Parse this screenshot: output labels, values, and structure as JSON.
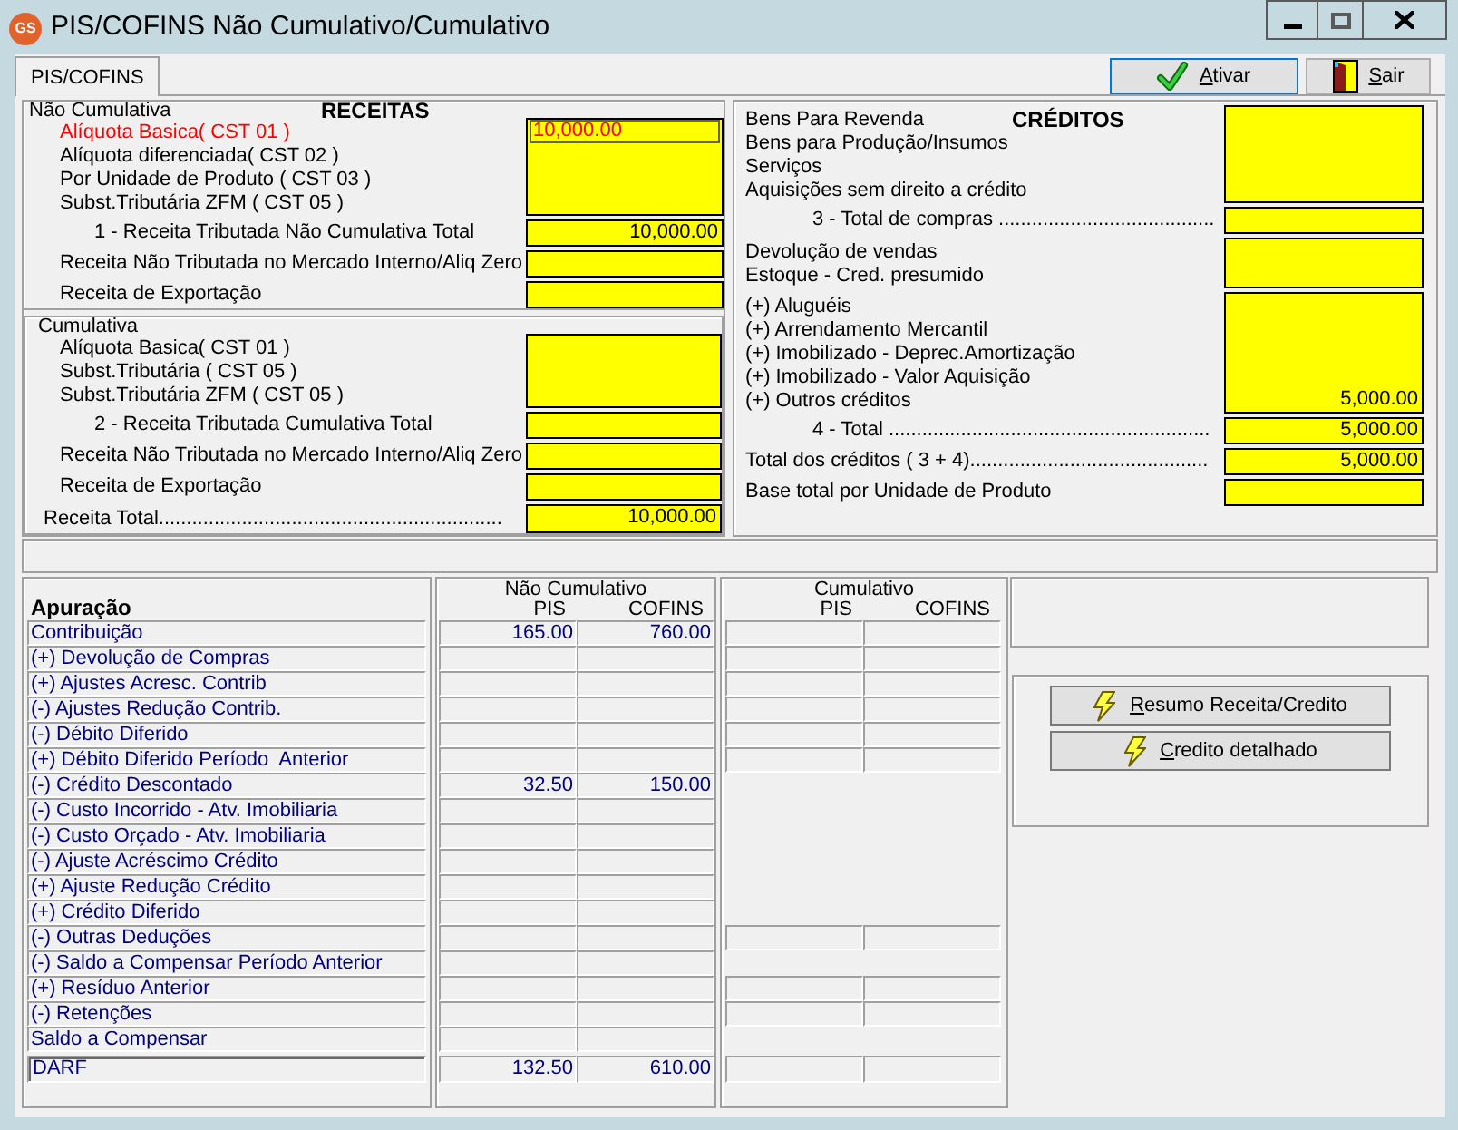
{
  "window": {
    "logo": "GS",
    "title": "PIS/COFINS Não Cumulativo/Cumulativo"
  },
  "tabs": [
    {
      "label": "PIS/COFINS",
      "selected": true
    }
  ],
  "toolbar": [
    {
      "label": "Ativar",
      "focused": true
    },
    {
      "label": "Sair",
      "focused": false
    }
  ],
  "receitas": {
    "title": "RECEITAS",
    "sections": [
      {
        "heading": "Não Cumulativa",
        "blocks": [
          {
            "kind": "group",
            "lines": [
              {
                "label": "Alíquota Basica( CST 01 )",
                "focused": true,
                "value": "10,000.00"
              },
              {
                "label": "Alíquota diferenciada( CST 02 )",
                "focused": false
              },
              {
                "label": "Por Unidade de Produto ( CST 03 )",
                "focused": false
              },
              {
                "label": "Subst.Tributária ZFM ( CST 05 )",
                "focused": false
              }
            ]
          },
          {
            "kind": "subtotal",
            "label": "1 - Receita Tributada Não Cumulativa Total",
            "value": "10,000.00"
          },
          {
            "kind": "item",
            "label": "Receita Não Tributada no Mercado Interno/Aliq Zero"
          },
          {
            "kind": "item",
            "label": "Receita de Exportação"
          }
        ]
      },
      {
        "heading": "Cumulativa",
        "blocks": [
          {
            "kind": "group",
            "lines": [
              {
                "label": "Alíquota Basica( CST 01 )",
                "focused": false
              },
              {
                "label": "Subst.Tributária ( CST 05 )",
                "focused": false
              },
              {
                "label": "Subst.Tributária ZFM ( CST 05 )",
                "focused": false
              }
            ]
          },
          {
            "kind": "subtotal",
            "label": "2 - Receita Tributada Cumulativa Total"
          },
          {
            "kind": "item",
            "label": "Receita Não Tributada no Mercado Interno/Aliq Zero"
          },
          {
            "kind": "item",
            "label": "Receita de Exportação"
          },
          {
            "kind": "total",
            "label": "Receita Total..............................................................",
            "value": "10,000.00"
          }
        ]
      }
    ]
  },
  "creditos": {
    "title": "CRÉDITOS",
    "blocks": [
      {
        "kind": "group",
        "lines": [
          {
            "label": "Bens Para Revenda",
            "focused": false
          },
          {
            "label": "Bens para Produção/Insumos",
            "focused": false
          },
          {
            "label": "Serviços",
            "focused": false
          },
          {
            "label": "Aquisições sem direito a crédito",
            "focused": false
          }
        ]
      },
      {
        "kind": "subtotal",
        "label": "3 - Total de compras ......................................."
      },
      {
        "kind": "group",
        "lines": [
          {
            "label": "Devolução de vendas",
            "focused": false
          },
          {
            "label": "Estoque - Cred. presumido",
            "focused": false
          }
        ]
      },
      {
        "kind": "group",
        "lines": [
          {
            "label": "(+) Aluguéis",
            "focused": false
          },
          {
            "label": "(+) Arrendamento Mercantil",
            "focused": false
          },
          {
            "label": "(+) Imobilizado - Deprec.Amortização",
            "focused": false
          },
          {
            "label": "(+) Imobilizado - Valor Aquisição",
            "focused": false
          },
          {
            "label": "(+) Outros créditos",
            "focused": false,
            "value": "5,000.00"
          }
        ]
      },
      {
        "kind": "subtotal",
        "label": "4 - Total ..........................................................",
        "value": "5,000.00"
      },
      {
        "kind": "item",
        "label": "Total dos créditos ( 3 + 4)...........................................",
        "value": "5,000.00"
      },
      {
        "kind": "item",
        "label": "Base total por Unidade de Produto"
      }
    ]
  },
  "apuracao": {
    "title": "Apuração",
    "groups": [
      {
        "title": "Não Cumulativo",
        "columns": [
          "PIS",
          "COFINS"
        ]
      },
      {
        "title": "Cumulativo",
        "columns": [
          "PIS",
          "COFINS"
        ]
      }
    ],
    "rows": [
      {
        "label": "Contribuição",
        "nao_cumulativo": {
          "pis": "165.00",
          "cofins": "760.00"
        },
        "cumulativo_cells": true
      },
      {
        "label": "(+) Devolução de Compras",
        "cumulativo_cells": true
      },
      {
        "label": "(+) Ajustes Acresc. Contrib",
        "cumulativo_cells": true
      },
      {
        "label": "(-) Ajustes Redução Contrib.",
        "cumulativo_cells": true
      },
      {
        "label": "(-) Débito Diferido",
        "cumulativo_cells": true
      },
      {
        "label": "(+) Débito Diferido Período  Anterior",
        "cumulativo_cells": true
      },
      {
        "label": "(-) Crédito Descontado",
        "nao_cumulativo": {
          "pis": "32.50",
          "cofins": "150.00"
        },
        "cumulativo_cells": false
      },
      {
        "label": "(-) Custo Incorrido - Atv. Imobiliaria",
        "cumulativo_cells": false
      },
      {
        "label": "(-) Custo Orçado - Atv. Imobiliaria",
        "cumulativo_cells": false
      },
      {
        "label": "(-) Ajuste Acréscimo Crédito",
        "cumulativo_cells": false
      },
      {
        "label": "(+) Ajuste Redução Crédito",
        "cumulativo_cells": false
      },
      {
        "label": "(+) Crédito Diferido",
        "cumulativo_cells": false
      },
      {
        "label": "(-) Outras Deduções",
        "cumulativo_cells": true
      },
      {
        "label": "(-) Saldo a Compensar Período Anterior",
        "cumulativo_cells": false
      },
      {
        "label": "(+) Resíduo Anterior",
        "cumulativo_cells": true
      },
      {
        "label": "(-) Retenções",
        "cumulativo_cells": true
      },
      {
        "label": "Saldo a Compensar",
        "cumulativo_cells": false
      }
    ],
    "darf": {
      "label": "DARF",
      "nao_cumulativo": {
        "pis": "132.50",
        "cofins": "610.00"
      },
      "cumulativo_cells": true
    }
  },
  "actions": [
    "Resumo Receita/Credito",
    "Credito detalhado"
  ]
}
